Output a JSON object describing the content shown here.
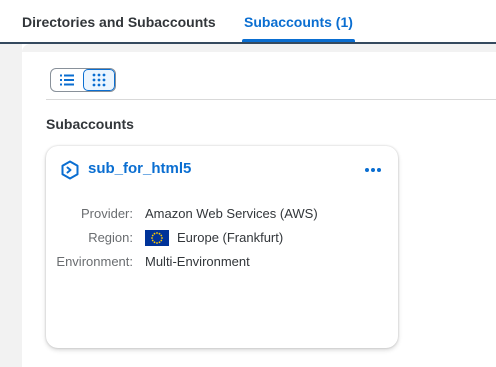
{
  "tabs": [
    {
      "label": "Directories and Subaccounts",
      "active": false
    },
    {
      "label": "Subaccounts (1)",
      "active": true
    }
  ],
  "view_toggle": {
    "options": [
      "list-icon",
      "grid-icon"
    ],
    "selected": "grid-icon"
  },
  "section": {
    "title": "Subaccounts"
  },
  "card": {
    "icon": "subaccount-icon",
    "title": "sub_for_html5",
    "more_icon": "more-icon",
    "fields": [
      {
        "label": "Provider:",
        "value": "Amazon Web Services (AWS)"
      },
      {
        "label": "Region:",
        "value": "Europe (Frankfurt)",
        "flag": "eu-flag-icon"
      },
      {
        "label": "Environment:",
        "value": "Multi-Environment"
      }
    ]
  },
  "colors": {
    "accent": "#0a6ed1",
    "header_border": "#354a5f",
    "label": "#6a6d70",
    "text": "#32363a",
    "eu_blue": "#003399",
    "eu_yellow": "#ffcc00"
  }
}
